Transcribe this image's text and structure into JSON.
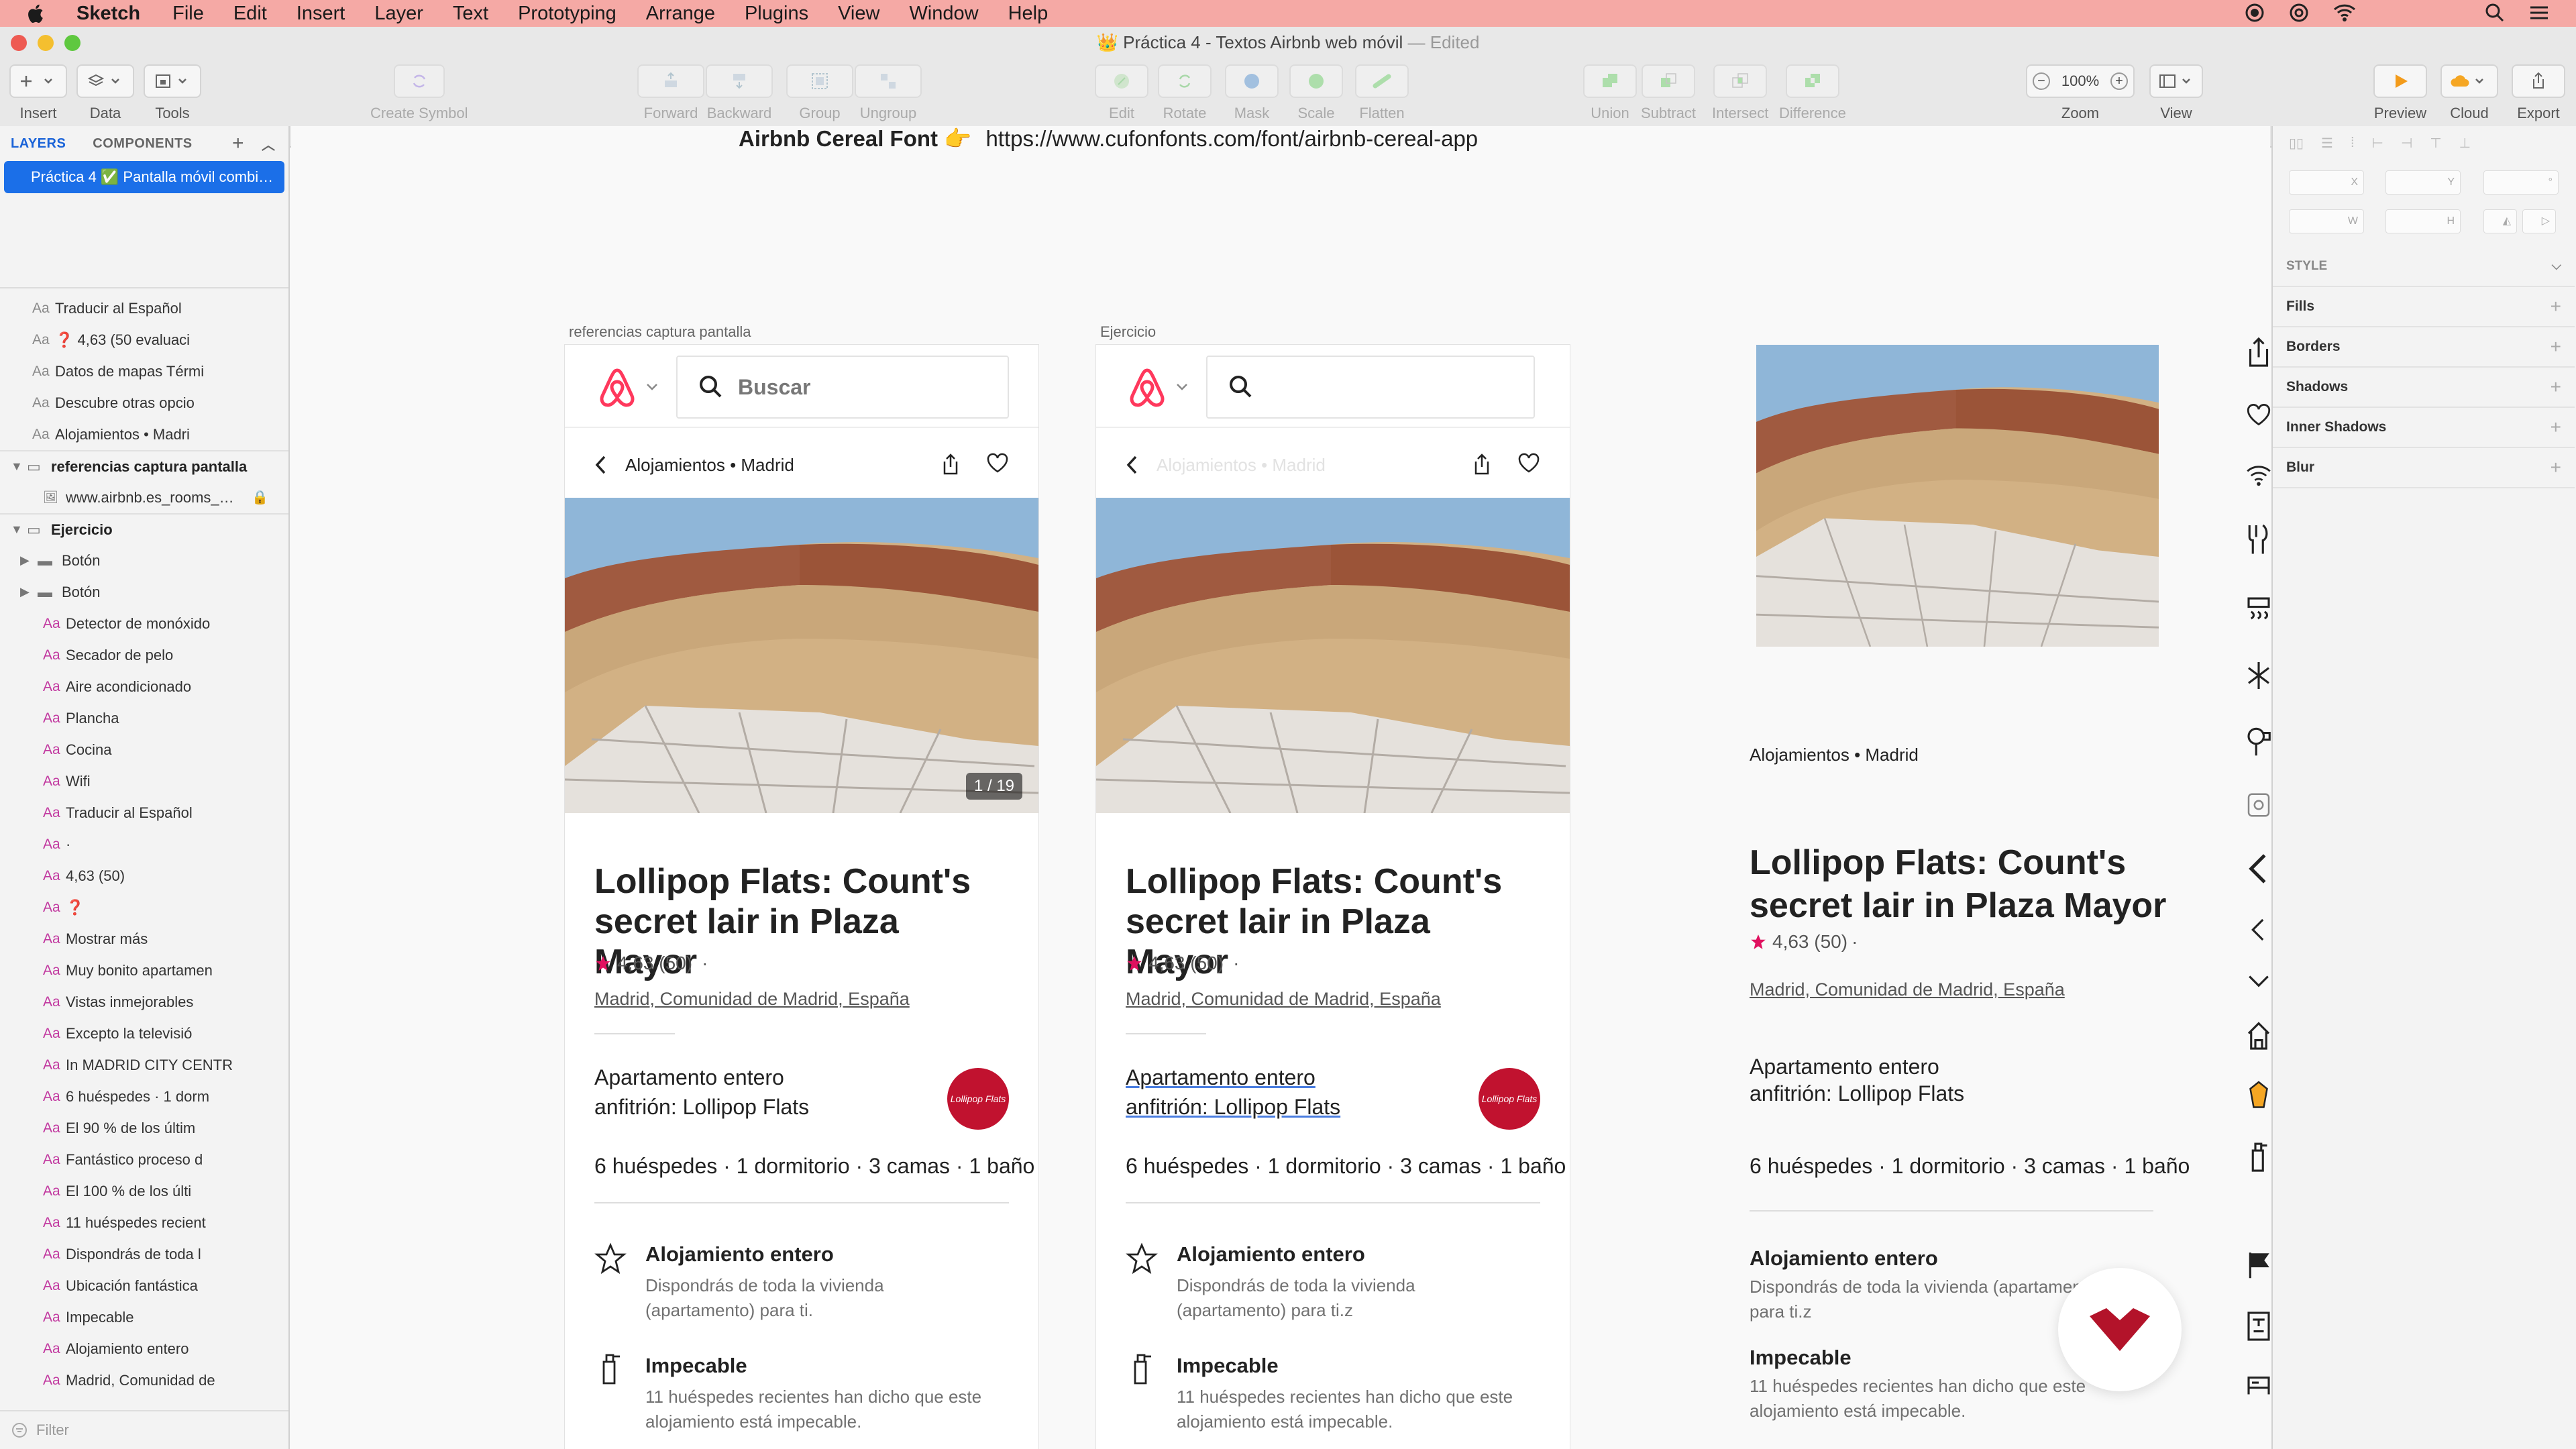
{
  "menubar": {
    "app": "Sketch",
    "items": [
      "File",
      "Edit",
      "Insert",
      "Layer",
      "Text",
      "Prototyping",
      "Arrange",
      "Plugins",
      "View",
      "Window",
      "Help"
    ]
  },
  "window": {
    "title": "👑 Práctica 4 - Textos Airbnb web móvil",
    "status": "— Edited"
  },
  "toolbar": {
    "insert": "Insert",
    "data": "Data",
    "tools": "Tools",
    "create_symbol": "Create Symbol",
    "forward": "Forward",
    "backward": "Backward",
    "group": "Group",
    "ungroup": "Ungroup",
    "edit": "Edit",
    "rotate": "Rotate",
    "mask": "Mask",
    "scale": "Scale",
    "flatten": "Flatten",
    "union": "Union",
    "subtract": "Subtract",
    "intersect": "Intersect",
    "difference": "Difference",
    "zoom_value": "100%",
    "zoom": "Zoom",
    "view": "View",
    "preview": "Preview",
    "cloud": "Cloud",
    "export": "Export"
  },
  "left_panel": {
    "tab_layers": "LAYERS",
    "tab_components": "COMPONENTS",
    "selected_page": "Práctica 4 ✅ Pantalla móvil combi…",
    "text_icon": "Aa",
    "top_layers": [
      "Traducir al Español",
      "❓ 4,63 (50 evaluaci",
      "Datos de mapas Térmi",
      "Descubre otras opcio",
      "Alojamientos • Madri"
    ],
    "group1": "referencias captura pantalla",
    "group1_child": "www.airbnb.es_rooms_…",
    "group2": "Ejercicio",
    "folders": [
      "Botón",
      "Botón"
    ],
    "ejercicio_layers": [
      "Detector de monóxido",
      "Secador de pelo",
      "Aire acondicionado",
      "Plancha",
      "Cocina",
      "Wifi",
      "Traducir al Español",
      "·",
      "4,63 (50)",
      "❓",
      "Mostrar más",
      "Muy bonito apartamen",
      "Vistas inmejorables",
      "Excepto la televisió",
      "In MADRID CITY CENTR",
      "6 huéspedes · 1 dorm",
      "El 90 % de los últim",
      "Fantástico proceso d",
      "El 100 % de los últi",
      "11 huéspedes recient",
      "Dispondrás de toda l",
      "Ubicación fantástica",
      "Impecable",
      "Alojamiento entero",
      "Madrid, Comunidad de"
    ],
    "filter": "Filter"
  },
  "canvas": {
    "font_note_label": "Airbnb Cereal Font 👉",
    "font_note_url": "https://www.cufonfonts.com/font/airbnb-cereal-app",
    "label_ref": "referencias captura pantalla",
    "label_ej": "Ejercicio",
    "search_placeholder": "Buscar",
    "nav_title": "Alojamientos • Madrid",
    "photo_counter": "1 / 19",
    "listing_title": "Lollipop Flats: Count's secret lair in Plaza Mayor",
    "rating": "4,63 (50)",
    "rating_dot": "·",
    "location": "Madrid, Comunidad de Madrid, España",
    "host_line1": "Apartamento entero",
    "host_line2": "anfitrión: Lollipop Flats",
    "amenities": "6 huéspedes · 1 dormitorio · 3 camas · 1 baño",
    "feat1_title": "Alojamiento entero",
    "feat1_text": "Dispondrás de toda la vivienda (apartamento) para ti.",
    "feat1_text_b": "Dispondrás de toda la vivienda (apartamento) para ti.z",
    "feat2_title": "Impecable",
    "feat2_text": "11 huéspedes recientes han dicho que este alojamiento está impecable."
  },
  "right_panel": {
    "style": "STYLE",
    "fills": "Fills",
    "borders": "Borders",
    "shadows": "Shadows",
    "inner_shadows": "Inner Shadows",
    "blur": "Blur",
    "x": "X",
    "y": "Y",
    "w": "W",
    "h": "H"
  },
  "colors": {
    "menubar": "#f5a9a5",
    "selection": "#1b6fe8",
    "airbnb": "#ff385c",
    "star": "#e0115f",
    "brand_logo": "#c1122f"
  }
}
